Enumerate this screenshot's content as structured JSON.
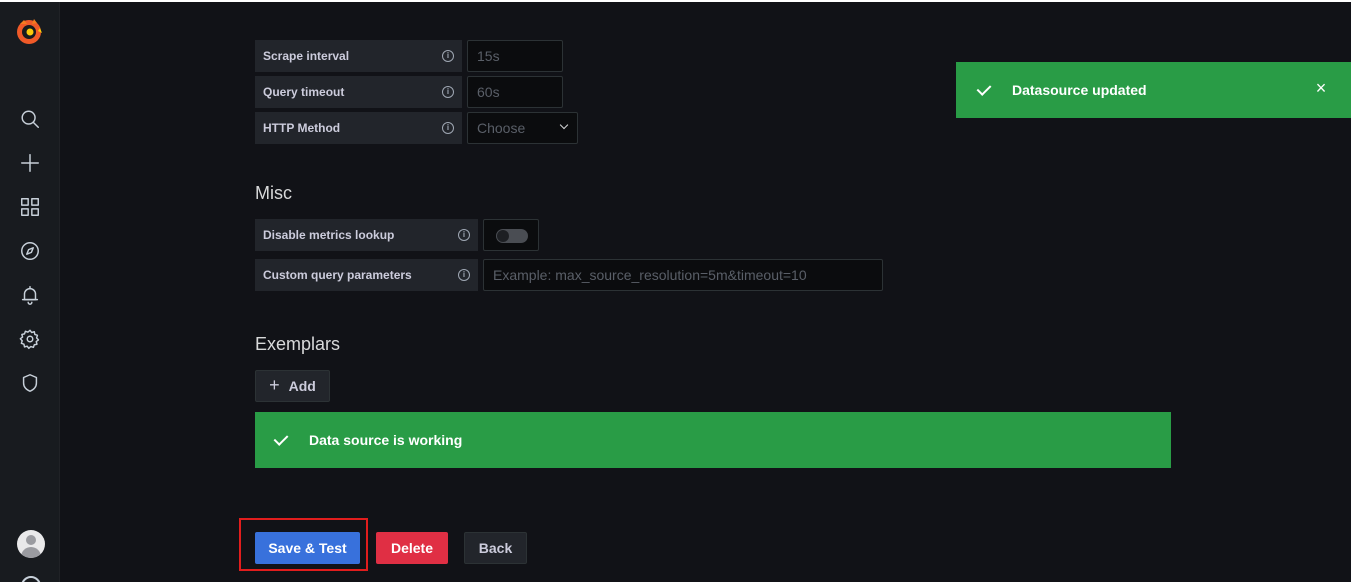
{
  "sidebar": {
    "items": [
      {
        "icon": "search-icon"
      },
      {
        "icon": "plus-icon"
      },
      {
        "icon": "dashboards-icon"
      },
      {
        "icon": "compass-icon"
      },
      {
        "icon": "bell-icon"
      },
      {
        "icon": "gear-icon"
      },
      {
        "icon": "shield-icon"
      }
    ],
    "logo": "grafana-logo"
  },
  "http_settings": {
    "scrape_interval": {
      "label": "Scrape interval",
      "placeholder": "15s"
    },
    "query_timeout": {
      "label": "Query timeout",
      "placeholder": "60s"
    },
    "http_method": {
      "label": "HTTP Method",
      "placeholder": "Choose"
    }
  },
  "misc": {
    "title": "Misc",
    "disable_metrics_lookup": {
      "label": "Disable metrics lookup",
      "enabled": false
    },
    "custom_query_parameters": {
      "label": "Custom query parameters",
      "placeholder": "Example: max_source_resolution=5m&timeout=10"
    }
  },
  "exemplars": {
    "title": "Exemplars",
    "add_label": "Add"
  },
  "status": {
    "message": "Data source is working",
    "color": "#299c46"
  },
  "toast": {
    "message": "Datasource updated",
    "close_symbol": "×"
  },
  "actions": {
    "save_test_label": "Save & Test",
    "delete_label": "Delete",
    "back_label": "Back"
  },
  "colors": {
    "primary": "#3871dc",
    "destructive": "#e02f44",
    "success": "#299c46",
    "highlight": "#e11d1d"
  }
}
